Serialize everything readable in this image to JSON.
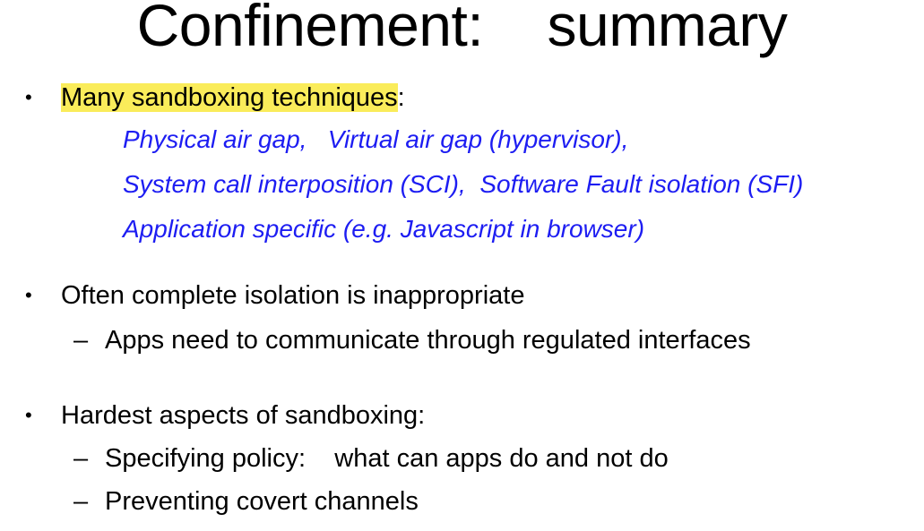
{
  "title": "Confinement:    summary",
  "bullets": [
    {
      "lead_highlight": "Many sandboxing techniques",
      "lead_tail": ":",
      "examples": [
        "Physical air gap,   Virtual air gap (hypervisor),",
        "System call interposition (SCI),  Software Fault isolation (SFI)",
        "Application specific (e.g. Javascript in browser)"
      ]
    },
    {
      "text": "Often complete isolation is inappropriate",
      "subs": [
        "Apps need to communicate through regulated interfaces"
      ]
    },
    {
      "text": "Hardest aspects of sandboxing:",
      "subs": [
        "Specifying policy:    what can apps do and not do",
        "Preventing covert channels"
      ]
    }
  ],
  "glyphs": {
    "bullet": "•",
    "dash": "–"
  },
  "colors": {
    "highlight": "#faec5a",
    "examples": "#1d1df2"
  }
}
